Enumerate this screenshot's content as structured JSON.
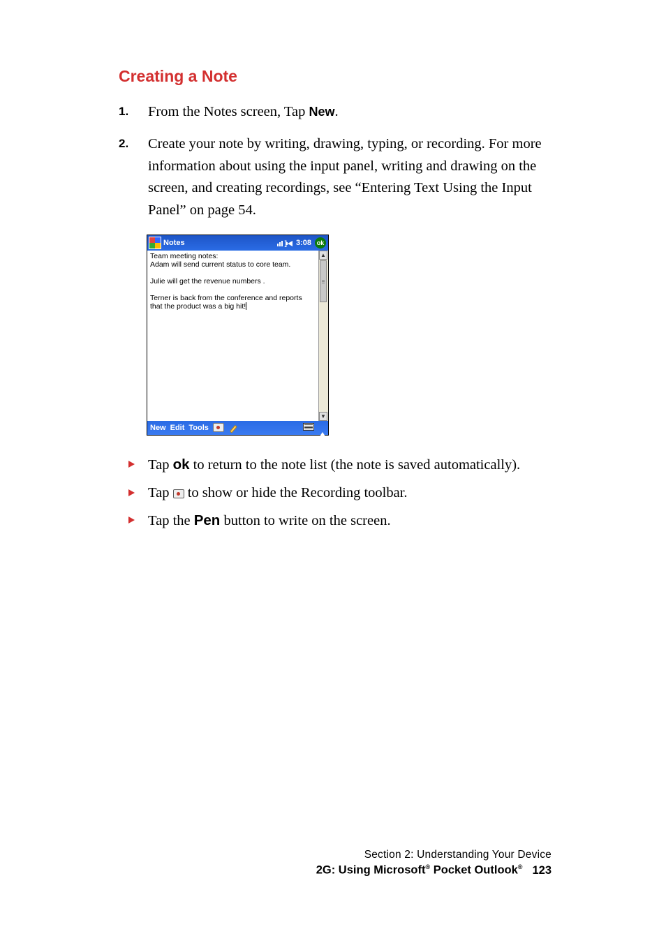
{
  "heading": "Creating a Note",
  "steps": {
    "s1": {
      "num": "1.",
      "pre": "From the Notes screen, Tap ",
      "bold": "New",
      "post": "."
    },
    "s2": {
      "num": "2.",
      "text": "Create your note by writing, drawing, typing, or recording. For more information about using the input panel, writing and drawing on the screen, and creating recordings, see “Entering Text Using the Input Panel” on page 54."
    }
  },
  "shot": {
    "title": "Notes",
    "clock": "3:08",
    "ok": "ok",
    "content": "Team meeting notes:\nAdam will send current status to core team.\n\nJulie will get the revenue numbers .\n\nTerner is back from the conference and reports that the product was a big hit!",
    "toolbar": {
      "new": "New",
      "edit": "Edit",
      "tools": "Tools"
    }
  },
  "tips": {
    "t1": {
      "pre": "Tap ",
      "bold": "ok",
      "post": " to return to the note list (the note is saved automatically)."
    },
    "t2": {
      "pre": "Tap ",
      "post": " to show or hide the Recording toolbar."
    },
    "t3": {
      "pre": "Tap the ",
      "bold": "Pen",
      "post": " button to write on the screen."
    }
  },
  "footer": {
    "section": "Section 2: Understanding Your Device",
    "chapter_pre": "2G: Using Microsoft",
    "chapter_mid": " Pocket Outlook",
    "page": "123"
  }
}
